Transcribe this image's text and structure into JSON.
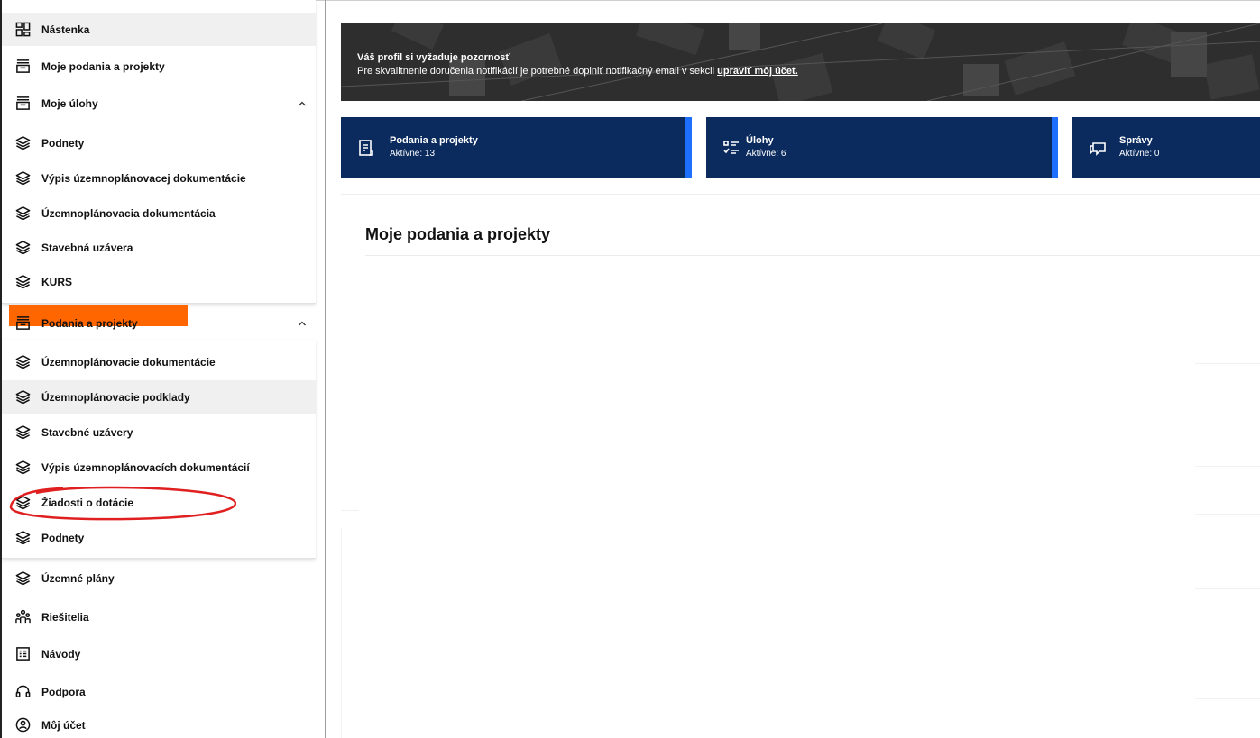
{
  "sidebar": {
    "items": [
      {
        "label": "Nástenka",
        "icon": "dashboard-icon"
      },
      {
        "label": "Moje podania a projekty",
        "icon": "inbox-icon"
      },
      {
        "label": "Moje úlohy",
        "icon": "inbox-icon"
      },
      {
        "label": "Podnety",
        "icon": "layers-icon"
      },
      {
        "label": "Výpis územnoplánovacej dokumentácie",
        "icon": "layers-icon"
      },
      {
        "label": "Územnoplánovacia dokumentácia",
        "icon": "layers-icon"
      },
      {
        "label": "Stavebná uzávera",
        "icon": "layers-icon"
      },
      {
        "label": "KURS",
        "icon": "layers-icon"
      },
      {
        "label": "Podania a projekty",
        "icon": "inbox-icon"
      },
      {
        "label": "Územnoplánovacie dokumentácie",
        "icon": "layers-icon"
      },
      {
        "label": "Územnoplánovacie podklady",
        "icon": "layers-icon"
      },
      {
        "label": "Stavebné uzávery",
        "icon": "layers-icon"
      },
      {
        "label": "Výpis územnoplánovacích dokumentácií",
        "icon": "layers-icon"
      },
      {
        "label": "Žiadosti o dotácie",
        "icon": "layers-icon"
      },
      {
        "label": "Podnety",
        "icon": "layers-icon"
      },
      {
        "label": "Územné plány",
        "icon": "layers-icon"
      },
      {
        "label": "Riešitelia",
        "icon": "people-icon"
      },
      {
        "label": "Návody",
        "icon": "document-icon"
      },
      {
        "label": "Podpora",
        "icon": "headset-icon"
      },
      {
        "label": "Môj účet",
        "icon": "account-icon"
      }
    ]
  },
  "banner": {
    "title": "Váš profil si vyžaduje pozornosť",
    "text": "Pre skvalitnenie doručenia notifikácií je potrebné doplniť notifikačný email v sekcii",
    "link": "upraviť môj účet."
  },
  "cards": [
    {
      "title": "Podania a projekty",
      "subtitle": "Aktívne: 13",
      "icon": "document-icon"
    },
    {
      "title": "Úlohy",
      "subtitle": "Aktívne: 6",
      "icon": "checklist-icon"
    },
    {
      "title": "Správy",
      "subtitle": "Aktívne: 0",
      "icon": "chat-icon"
    }
  ],
  "main": {
    "panel_title": "Moje podania a projekty"
  },
  "colors": {
    "card_bg": "#0b2b5e",
    "card_stripe": "#1f6fff",
    "highlight_orange": "#ff6600",
    "annotation_red": "#e02020"
  }
}
